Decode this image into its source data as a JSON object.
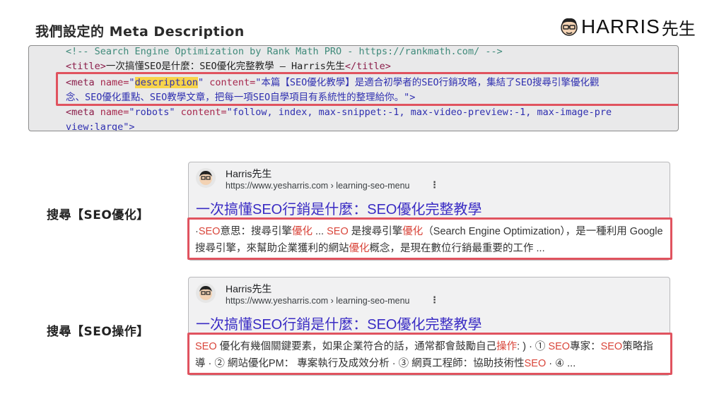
{
  "heading": "我們設定的 Meta Description",
  "brand": {
    "name": "HARRIS",
    "suffix": "先生",
    "icon": "face-icon"
  },
  "code": {
    "line1": "<!-- Search Engine Optimization by Rank Math PRO - https://rankmath.com/ -->",
    "line2_open": "<title>",
    "line2_text": "一次搞懂SEO是什麼：SEO優化完整教學 – Harris先生",
    "line2_close": "</title>",
    "line3_a": "<meta ",
    "line3_b": "name=",
    "line3_c": "\"",
    "line3_hl": "description",
    "line3_d": "\"",
    "line3_e": " content=",
    "line3_f": "\"本篇【SEO優化教學】是適合初學者的SEO行銷攻略，集結了SEO搜尋引擎優化觀",
    "line4": "念、SEO優化重點、SEO教學文章，把每一項SEO自學項目有系統性的整理給你。\">",
    "line5_a": "<meta ",
    "line5_b": "name=",
    "line5_c": "\"robots\"",
    "line5_e": " content=",
    "line5_f": "\"follow, index, max-snippet:-1, max-video-preview:-1, max-image-pre",
    "line6": "view:large\">"
  },
  "results": [
    {
      "label": "搜尋【SEO優化】",
      "site": "Harris先生",
      "url": "https://www.yesharris.com › learning-seo-menu",
      "title": "一次搞懂SEO行銷是什麼：SEO優化完整教學",
      "snippet_parts": [
        {
          "t": "·",
          "h": false
        },
        {
          "t": "SEO",
          "h": true
        },
        {
          "t": "意思：搜尋引擎",
          "h": false
        },
        {
          "t": "優化",
          "h": true
        },
        {
          "t": " ... ",
          "h": false
        },
        {
          "t": "SEO",
          "h": true
        },
        {
          "t": " 是搜尋引擎",
          "h": false
        },
        {
          "t": "優化",
          "h": true
        },
        {
          "t": "（Search Engine Optimization），是一種利用 Google 搜尋引擎，來幫助企業獲利的網站",
          "h": false
        },
        {
          "t": "優化",
          "h": true
        },
        {
          "t": "概念，是現在數位行銷最重要的工作 ...",
          "h": false
        }
      ]
    },
    {
      "label": "搜尋【SEO操作】",
      "site": "Harris先生",
      "url": "https://www.yesharris.com › learning-seo-menu",
      "title": "一次搞懂SEO行銷是什麼：SEO優化完整教學",
      "snippet_parts": [
        {
          "t": "SEO",
          "h": true
        },
        {
          "t": " 優化有幾個關鍵要素，如果企業符合的話，通常都會鼓勵自己",
          "h": false
        },
        {
          "t": "操作",
          "h": true
        },
        {
          "t": ": ) · ① ",
          "h": false
        },
        {
          "t": "SEO",
          "h": true
        },
        {
          "t": "專家：",
          "h": false
        },
        {
          "t": "SEO",
          "h": true
        },
        {
          "t": "策略指導 · ② 網站優化PM： 專案執行及成效分析 · ③ 網頁工程師：協助技術性",
          "h": false
        },
        {
          "t": "SEO",
          "h": true
        },
        {
          "t": " · ④ ...",
          "h": false
        }
      ]
    }
  ]
}
